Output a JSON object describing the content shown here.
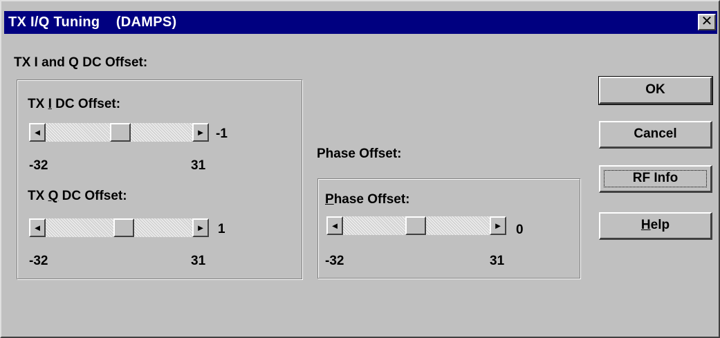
{
  "window": {
    "title": "TX I/Q Tuning    (DAMPS)",
    "close_glyph": "✕",
    "title_bar_color": "#000080"
  },
  "dc_offset": {
    "group_label": "TX I and Q DC Offset:",
    "i_offset": {
      "label_prefix": "TX ",
      "label_mnemonic": "I",
      "label_suffix": " DC Offset:",
      "value": "-1",
      "min": "-32",
      "max": "31"
    },
    "q_offset": {
      "label_prefix": "TX ",
      "label_mnemonic": "Q",
      "label_suffix": " DC Offset:",
      "value": "1",
      "min": "-32",
      "max": "31"
    }
  },
  "phase": {
    "group_label": "Phase Offset:",
    "label_mnemonic": "P",
    "label_suffix": "hase Offset:",
    "value": "0",
    "min": "-32",
    "max": "31"
  },
  "buttons": {
    "ok": "OK",
    "cancel": "Cancel",
    "rf_info": "RF Info",
    "help_mnemonic": "H",
    "help_suffix": "elp"
  },
  "icons": {
    "left_arrow": "◄",
    "right_arrow": "►"
  }
}
